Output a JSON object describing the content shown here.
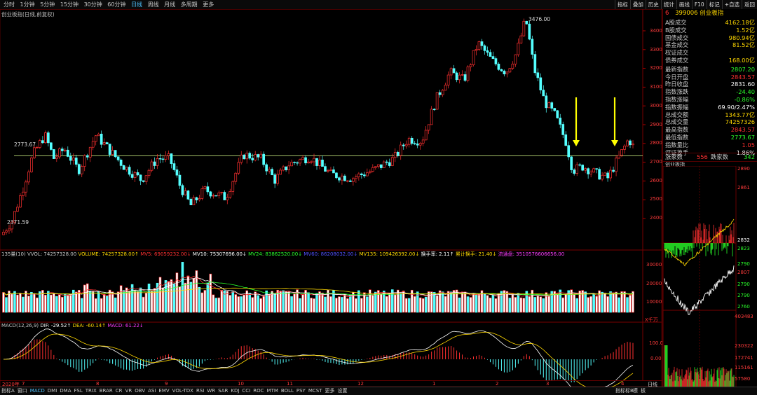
{
  "toolbar": {
    "timeframes": [
      "分时",
      "1分钟",
      "5分钟",
      "15分钟",
      "30分钟",
      "60分钟",
      "日线",
      "周线",
      "月线",
      "多周期",
      "更多"
    ],
    "active_timeframe": "日线",
    "tools": [
      "指标",
      "叠加",
      "历史",
      "统计",
      "画线",
      "F10",
      "标记",
      "+自选",
      "返回"
    ]
  },
  "chart_title": "创业板指(日线,前复权)",
  "price_chart": {
    "ma_line_label": "2773.67",
    "high_label": "3476.00",
    "low_label": "2371.59",
    "y_ticks": [
      "3400",
      "3300",
      "3200",
      "3100",
      "3000",
      "2900",
      "2800",
      "2700",
      "2600",
      "2500",
      "2400"
    ]
  },
  "volume_header": {
    "items": [
      {
        "text": "135量(10)",
        "color": "#c8c8c8"
      },
      {
        "text": "VVOL: 74257328.00",
        "color": "#c8c8c8"
      },
      {
        "text": "VOLUME: 74257328.00↑",
        "color": "#ffd800"
      },
      {
        "text": "MV5: 69059232.00↓",
        "color": "#ff3030"
      },
      {
        "text": "MV10: 75307696.00↓",
        "color": "#ffffff"
      },
      {
        "text": "MV24: 83862520.00↓",
        "color": "#2aff2a"
      },
      {
        "text": "MV60: 86208032.00↓",
        "color": "#5050ff"
      },
      {
        "text": "MV135: 109426392.00↓",
        "color": "#ffd800"
      },
      {
        "text": "换手率: 2.11↑",
        "color": "#ffffff"
      },
      {
        "text": "累计换手: 21.40↓",
        "color": "#ffd800"
      },
      {
        "text": "流通盘: 3510576606656.00",
        "color": "#ff3cff"
      }
    ],
    "y_ticks": [
      "30000",
      "20000",
      "10000"
    ]
  },
  "macd_header": {
    "items": [
      {
        "text": "MACD(12,26,9)",
        "color": "#c8c8c8"
      },
      {
        "text": "DIF: -29.52↑",
        "color": "#ffffff"
      },
      {
        "text": "DEA: -60.14↑",
        "color": "#ffd800"
      },
      {
        "text": "MACD: 61.22↓",
        "color": "#ff3cff"
      }
    ],
    "unit": "X千万",
    "y_ticks": [
      "100.0",
      "0.00"
    ]
  },
  "x_axis": {
    "labels": [
      "2020年",
      "7",
      "8",
      "9",
      "10",
      "11",
      "12",
      "1",
      "2",
      "3",
      "4"
    ],
    "end_label": "日线"
  },
  "quote_panel": {
    "code": "399006",
    "name": "创业板指",
    "rows": [
      {
        "k": "A股成交",
        "v": "4162.18亿",
        "c": "#ffd800"
      },
      {
        "k": "B股成交",
        "v": "1.52亿",
        "c": "#ffd800"
      },
      {
        "k": "国债成交",
        "v": "980.94亿",
        "c": "#ffd800"
      },
      {
        "k": "基金成交",
        "v": "81.52亿",
        "c": "#ffd800"
      },
      {
        "k": "权证成交",
        "v": "",
        "c": "#ffd800"
      },
      {
        "k": "债券成交",
        "v": "168.00亿",
        "c": "#ffd800"
      },
      {
        "k": "最新指数",
        "v": "2807.20",
        "c": "#2aff2a"
      },
      {
        "k": "今日开盘",
        "v": "2843.57",
        "c": "#ff3030"
      },
      {
        "k": "昨日收盘",
        "v": "2831.60",
        "c": "#ffffff"
      },
      {
        "k": "指数涨跌",
        "v": "-24.40",
        "c": "#2aff2a"
      },
      {
        "k": "指数涨幅",
        "v": "-0.86%",
        "c": "#2aff2a"
      },
      {
        "k": "指数振幅",
        "v": "69.90/2.47%",
        "c": "#ffffff"
      },
      {
        "k": "总成交额",
        "v": "1343.77亿",
        "c": "#ffd800"
      },
      {
        "k": "总成交量",
        "v": "74257326",
        "c": "#ffd800"
      },
      {
        "k": "最高指数",
        "v": "2843.57",
        "c": "#ff3030"
      },
      {
        "k": "最低指数",
        "v": "2773.67",
        "c": "#2aff2a"
      },
      {
        "k": "指数量比",
        "v": "1.05",
        "c": "#ff3030"
      },
      {
        "k": "评证换手",
        "v": "1.86%",
        "c": "#ffffff"
      }
    ],
    "up_label": "涨家数",
    "up_value": "556",
    "down_label": "跌家数",
    "down_value": "342",
    "mini_title": "创业板指",
    "mini_ticks_top": [
      "2890",
      "2861",
      "2832",
      "2823",
      "2790"
    ],
    "mini_ticks_mid": [
      "2807",
      "2790",
      "2790",
      "2760"
    ],
    "mini_ticks_vol": [
      "403483",
      "230322",
      "172741",
      "115161",
      "57580"
    ]
  },
  "bottom_tabs": [
    "指标A",
    "窗口",
    "MACD",
    "DMI",
    "DMA",
    "FSL",
    "TRIX",
    "BRAR",
    "CR",
    "VR",
    "OBV",
    "ASI",
    "EMV",
    "VOL-TDX",
    "RSI",
    "WR",
    "SAR",
    "KDJ",
    "CCI",
    "ROC",
    "MTM",
    "BOLL",
    "PSY",
    "MCST",
    "更多",
    "设置"
  ],
  "bottom_right": [
    "指标标B",
    "模",
    "板"
  ]
}
